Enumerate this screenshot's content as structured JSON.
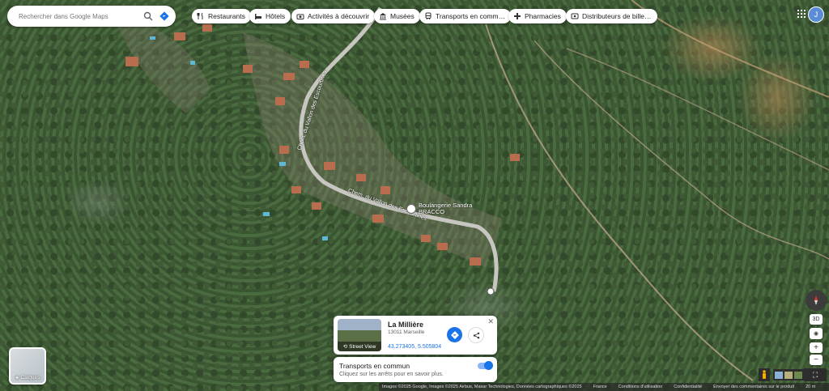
{
  "search": {
    "placeholder": "Rechercher dans Google Maps"
  },
  "categories": [
    {
      "label": "Restaurants",
      "icon": "fork-knife-icon"
    },
    {
      "label": "Hôtels",
      "icon": "bed-icon"
    },
    {
      "label": "Activités à découvrir",
      "icon": "camera-icon"
    },
    {
      "label": "Musées",
      "icon": "museum-icon"
    },
    {
      "label": "Transports en comm…",
      "icon": "train-icon"
    },
    {
      "label": "Pharmacies",
      "icon": "pharmacy-icon"
    },
    {
      "label": "Distributeurs de bille…",
      "icon": "dollar-icon"
    }
  ],
  "account": {
    "initial": "J"
  },
  "map_labels": {
    "poi": "Boulangerie Sandra BRACCO",
    "street_1": "Chem. du Vallon des Escourtines",
    "street_2": "Chem. du Vallon des Escourtines"
  },
  "place_card": {
    "title": "La Millière",
    "address": "13011 Marseille",
    "coords": "43.273405, 5.505804",
    "street_view": "Street View"
  },
  "transit_card": {
    "title": "Transports en commun",
    "subtitle": "Cliquez sur les arrêts pour en savoir plus."
  },
  "layers": {
    "label": "Calques"
  },
  "controls": {
    "view_3d": "3D"
  },
  "footer": {
    "attribution": "Images ©2025 Google, Images ©2025 Airbus, Maxar Technologies, Données cartographiques ©2025",
    "country": "France",
    "terms": "Conditions d'utilisation",
    "privacy": "Confidentialité",
    "feedback": "Envoyer des commentaires sur le produit",
    "scale": "20 m"
  }
}
